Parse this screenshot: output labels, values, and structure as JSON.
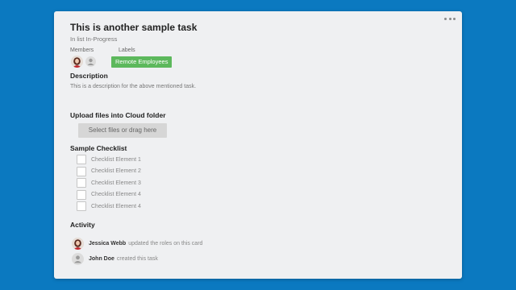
{
  "card": {
    "title": "This is another sample task",
    "list_prefix": "In list ",
    "list_name": "In-Progress",
    "members_label": "Members",
    "labels_label": "Labels",
    "label_badge": "Remote Employees",
    "label_color": "#5cb85c",
    "description_title": "Description",
    "description_text": "This is a description for the above mentioned task.",
    "upload_title": "Upload files into Cloud folder",
    "upload_button": "Select files or drag here",
    "checklist_title": "Sample Checklist",
    "checklist_items": [
      {
        "label": "Checklist Element 1",
        "checked": false
      },
      {
        "label": "Checklist Element 2",
        "checked": false
      },
      {
        "label": "Checklist Element 3",
        "checked": false
      },
      {
        "label": "Checklist Element 4",
        "checked": false
      },
      {
        "label": "Checklist Element 4",
        "checked": false
      }
    ],
    "activity_title": "Activity",
    "activity": [
      {
        "user": "Jessica Webb",
        "action": "updated the roles on this card",
        "avatar": "photo"
      },
      {
        "user": "John Doe",
        "action": "created this task",
        "avatar": "placeholder"
      }
    ]
  },
  "colors": {
    "background": "#0b79c0",
    "card": "#eff0f2"
  },
  "icons": {
    "menu": "more-horizontal-icon",
    "member_placeholder": "user-icon"
  }
}
